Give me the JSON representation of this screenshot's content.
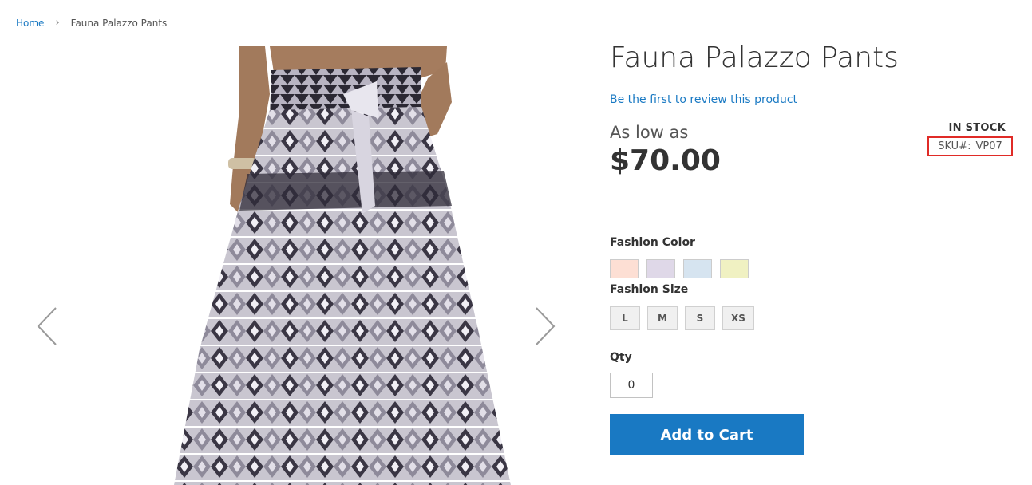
{
  "breadcrumb": {
    "home": "Home",
    "separator": "›",
    "current": "Fauna Palazzo Pants"
  },
  "gallery": {
    "prev_icon": "chevron-left-icon",
    "next_icon": "chevron-right-icon"
  },
  "product": {
    "name": "Fauna Palazzo Pants",
    "review_link": "Be the first to review this product",
    "price_prefix": "As low as",
    "price": "$70.00",
    "stock": "IN STOCK",
    "sku_label": "SKU#:",
    "sku_value": "VP07"
  },
  "options": {
    "color_label": "Fashion Color",
    "colors": [
      "#fddfd4",
      "#dfd8e8",
      "#d6e4f0",
      "#f0f1c2"
    ],
    "size_label": "Fashion Size",
    "sizes": [
      "L",
      "M",
      "S",
      "XS"
    ]
  },
  "qty": {
    "label": "Qty",
    "value": "0"
  },
  "cart": {
    "label": "Add to Cart",
    "color": "#1979c3"
  }
}
